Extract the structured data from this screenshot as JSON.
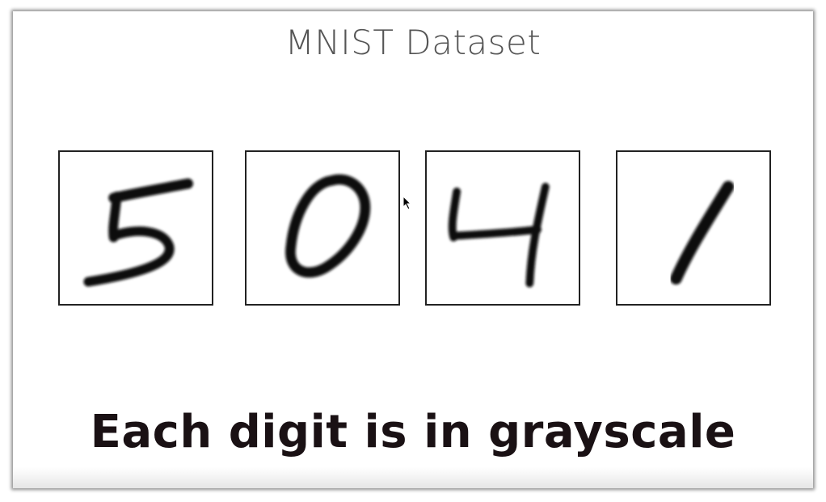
{
  "slide": {
    "title": "MNIST Dataset",
    "caption": "Each digit is in grayscale"
  },
  "digits": [
    {
      "label": "5"
    },
    {
      "label": "0"
    },
    {
      "label": "4"
    },
    {
      "label": "1"
    }
  ],
  "colors": {
    "title": "#555555",
    "caption": "#1a1114",
    "stroke": "#111111"
  }
}
